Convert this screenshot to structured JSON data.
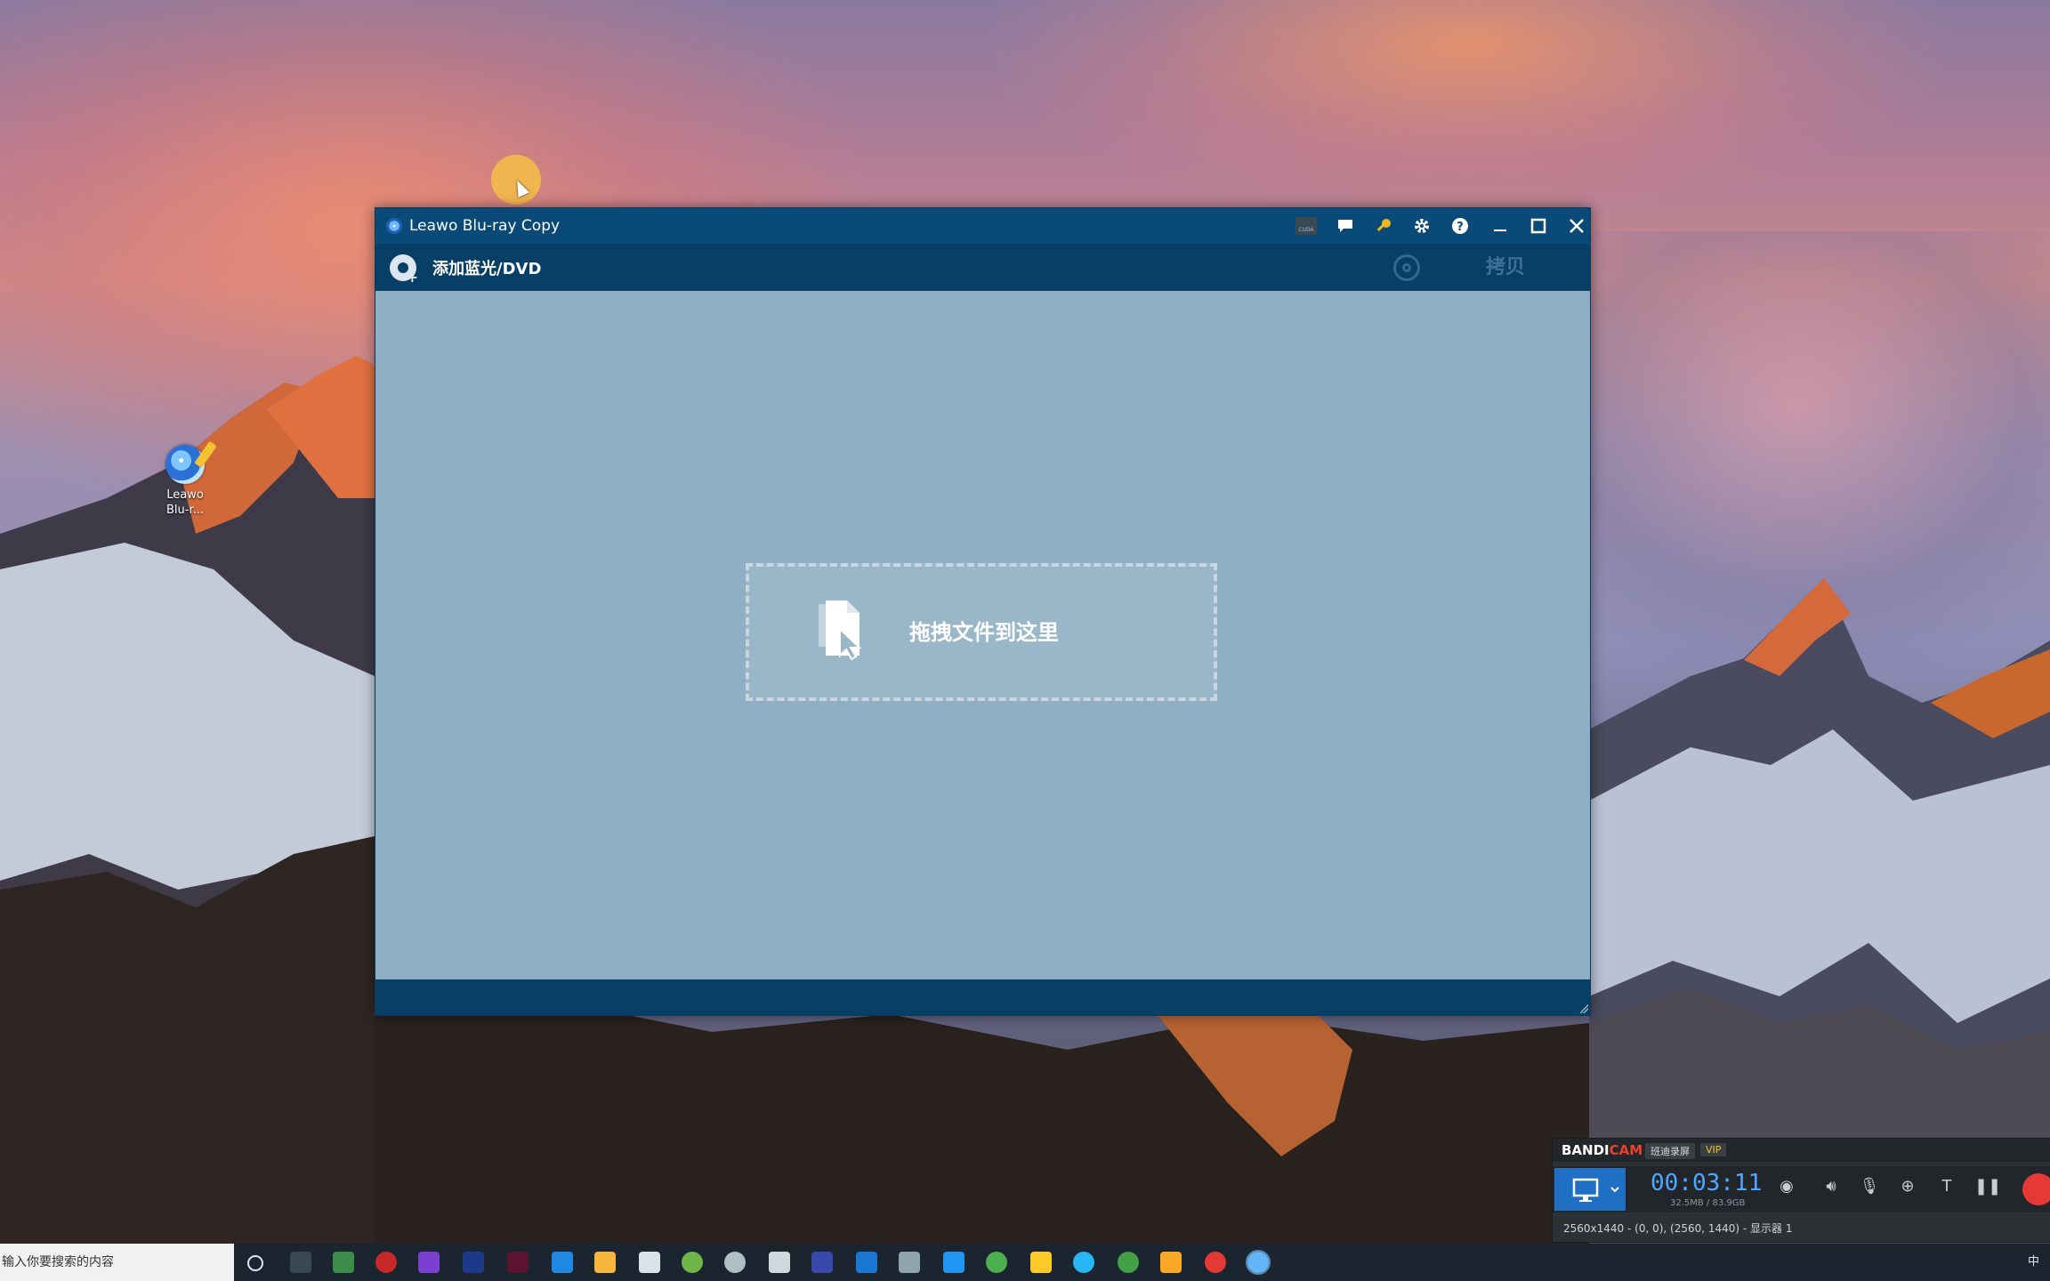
{
  "desktop": {
    "icon_label_line1": "Leawo",
    "icon_label_line2": "Blu-r..."
  },
  "window": {
    "title": "Leawo Blu-ray Copy",
    "titlebar_icons": [
      "cuda-icon",
      "chat-icon",
      "key-icon",
      "gear-icon",
      "help-icon",
      "minimize-icon",
      "maximize-icon",
      "close-icon"
    ],
    "cuda_label": "CUDA"
  },
  "toolbar": {
    "add_label": "添加蓝光/DVD",
    "copy_label": "拷贝"
  },
  "dropzone": {
    "label": "拖拽文件到这里"
  },
  "bandicam": {
    "brand_a": "BANDI",
    "brand_b": "CAM",
    "tag_cn": "班迪录屏",
    "tag_vip": "VIP",
    "time": "00:03:11",
    "size": "32.5MB / 83.9GB",
    "info": "2560x1440 - (0, 0), (2560, 1440) - 显示器 1"
  },
  "taskbar": {
    "search_placeholder": "输入你要搜索的内容",
    "ime": "中"
  },
  "colors": {
    "titlebar": "#094a78",
    "toolbar": "#073f66",
    "content": "#8fafc4",
    "dropzone_border": "#c7d6e1"
  }
}
